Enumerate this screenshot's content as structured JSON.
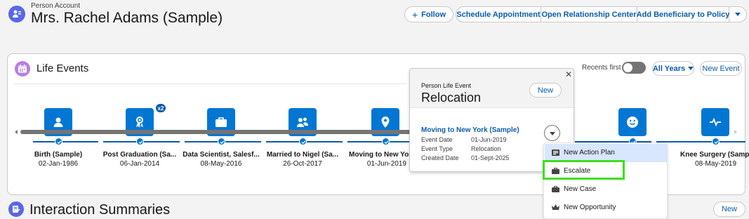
{
  "header": {
    "kicker": "Person Account",
    "name": "Mrs. Rachel Adams (Sample)",
    "actions": {
      "follow": "Follow",
      "schedule": "Schedule Appointment",
      "relationship": "Open Relationship Center",
      "beneficiary": "Add Beneficiary to Policy"
    }
  },
  "life_events": {
    "title": "Life Events",
    "recents_label": "Recents first",
    "years_label": "All Years",
    "new_label": "New Event",
    "events": [
      {
        "name": "Birth (Sample)",
        "date": "02-Jan-1986",
        "icon": "person-icon"
      },
      {
        "name": "Post Graduation (Sa...",
        "date": "06-Jan-2014",
        "icon": "graduation-icon",
        "badge": "x2"
      },
      {
        "name": "Data Scientist, Salesf...",
        "date": "08-May-2016",
        "icon": "briefcase-icon"
      },
      {
        "name": "Married to Nigel (Sa...",
        "date": "26-Oct-2017",
        "icon": "couple-icon"
      },
      {
        "name": "Moving to New Yor",
        "date": "01-Jun-2019",
        "icon": "location-pin-icon"
      },
      {
        "name": "",
        "date": "",
        "icon": "smiley-icon"
      },
      {
        "name": "Knee Surgery (Samp",
        "date": "08-May-2019",
        "icon": "heartbeat-icon"
      }
    ]
  },
  "popover": {
    "kicker": "Person Life Event",
    "title": "Relocation",
    "new_label": "New",
    "link": "Moving to New York (Sample)",
    "fields": [
      {
        "label": "Event Date",
        "value": "01-Jun-2019"
      },
      {
        "label": "Event Type",
        "value": "Relocation"
      },
      {
        "label": "Created Date",
        "value": "01-Sept-2025"
      }
    ]
  },
  "menu": {
    "items": [
      {
        "label": "New Action Plan",
        "icon": "action-plan-icon"
      },
      {
        "label": "Escalate",
        "icon": "briefcase-icon"
      },
      {
        "label": "New Case",
        "icon": "briefcase-icon"
      },
      {
        "label": "New Opportunity",
        "icon": "crown-icon"
      }
    ]
  },
  "interaction": {
    "title": "Interaction Summaries",
    "new_label": "New"
  },
  "colors": {
    "brand": "#0176d3",
    "link": "#0b5cab",
    "highlight": "#3fdf1a"
  }
}
